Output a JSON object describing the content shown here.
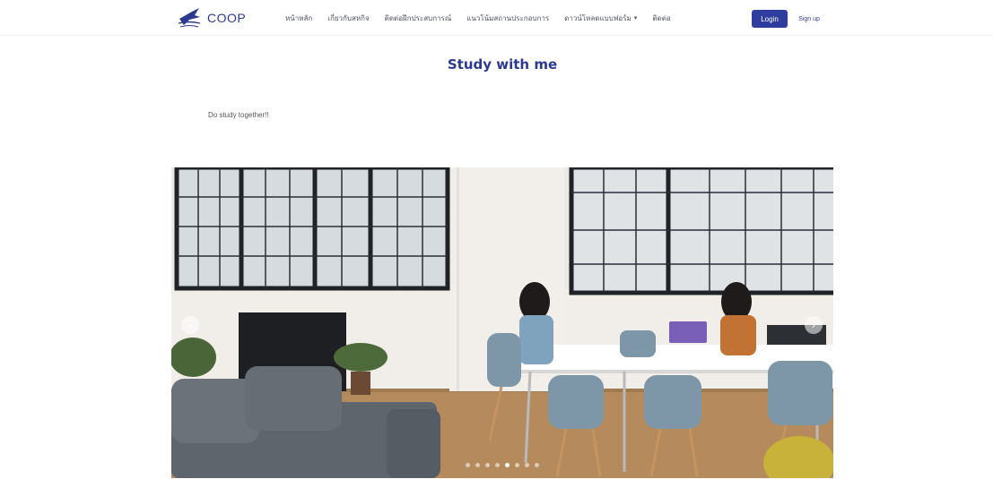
{
  "header": {
    "brand": {
      "name": "COOP"
    },
    "nav": [
      {
        "label": "หน้าหลัก",
        "icon": ""
      },
      {
        "label": "เกี่ยวกับสหกิจ",
        "icon": ""
      },
      {
        "label": "ติดต่อฝึกประสบการณ์",
        "icon": ""
      },
      {
        "label": "แนวโน้มสถานประกอบการ",
        "icon": ""
      },
      {
        "label": "ดาวน์โหลดแบบฟอร์ม",
        "icon": "chevron-down-icon"
      },
      {
        "label": "ติดต่อ",
        "icon": ""
      }
    ],
    "login_label": "Login",
    "signup_label": "Sign up"
  },
  "main": {
    "title": "Study with me",
    "intro": "Do study together!!"
  },
  "carousel": {
    "prev_icon": "chevron-left-icon",
    "next_icon": "chevron-right-icon",
    "slide_count": 8,
    "active_index": 4
  },
  "colors": {
    "brand": "#2b3a8f",
    "login_button": "#2f3e9e",
    "nav_text": "#4d5363"
  }
}
